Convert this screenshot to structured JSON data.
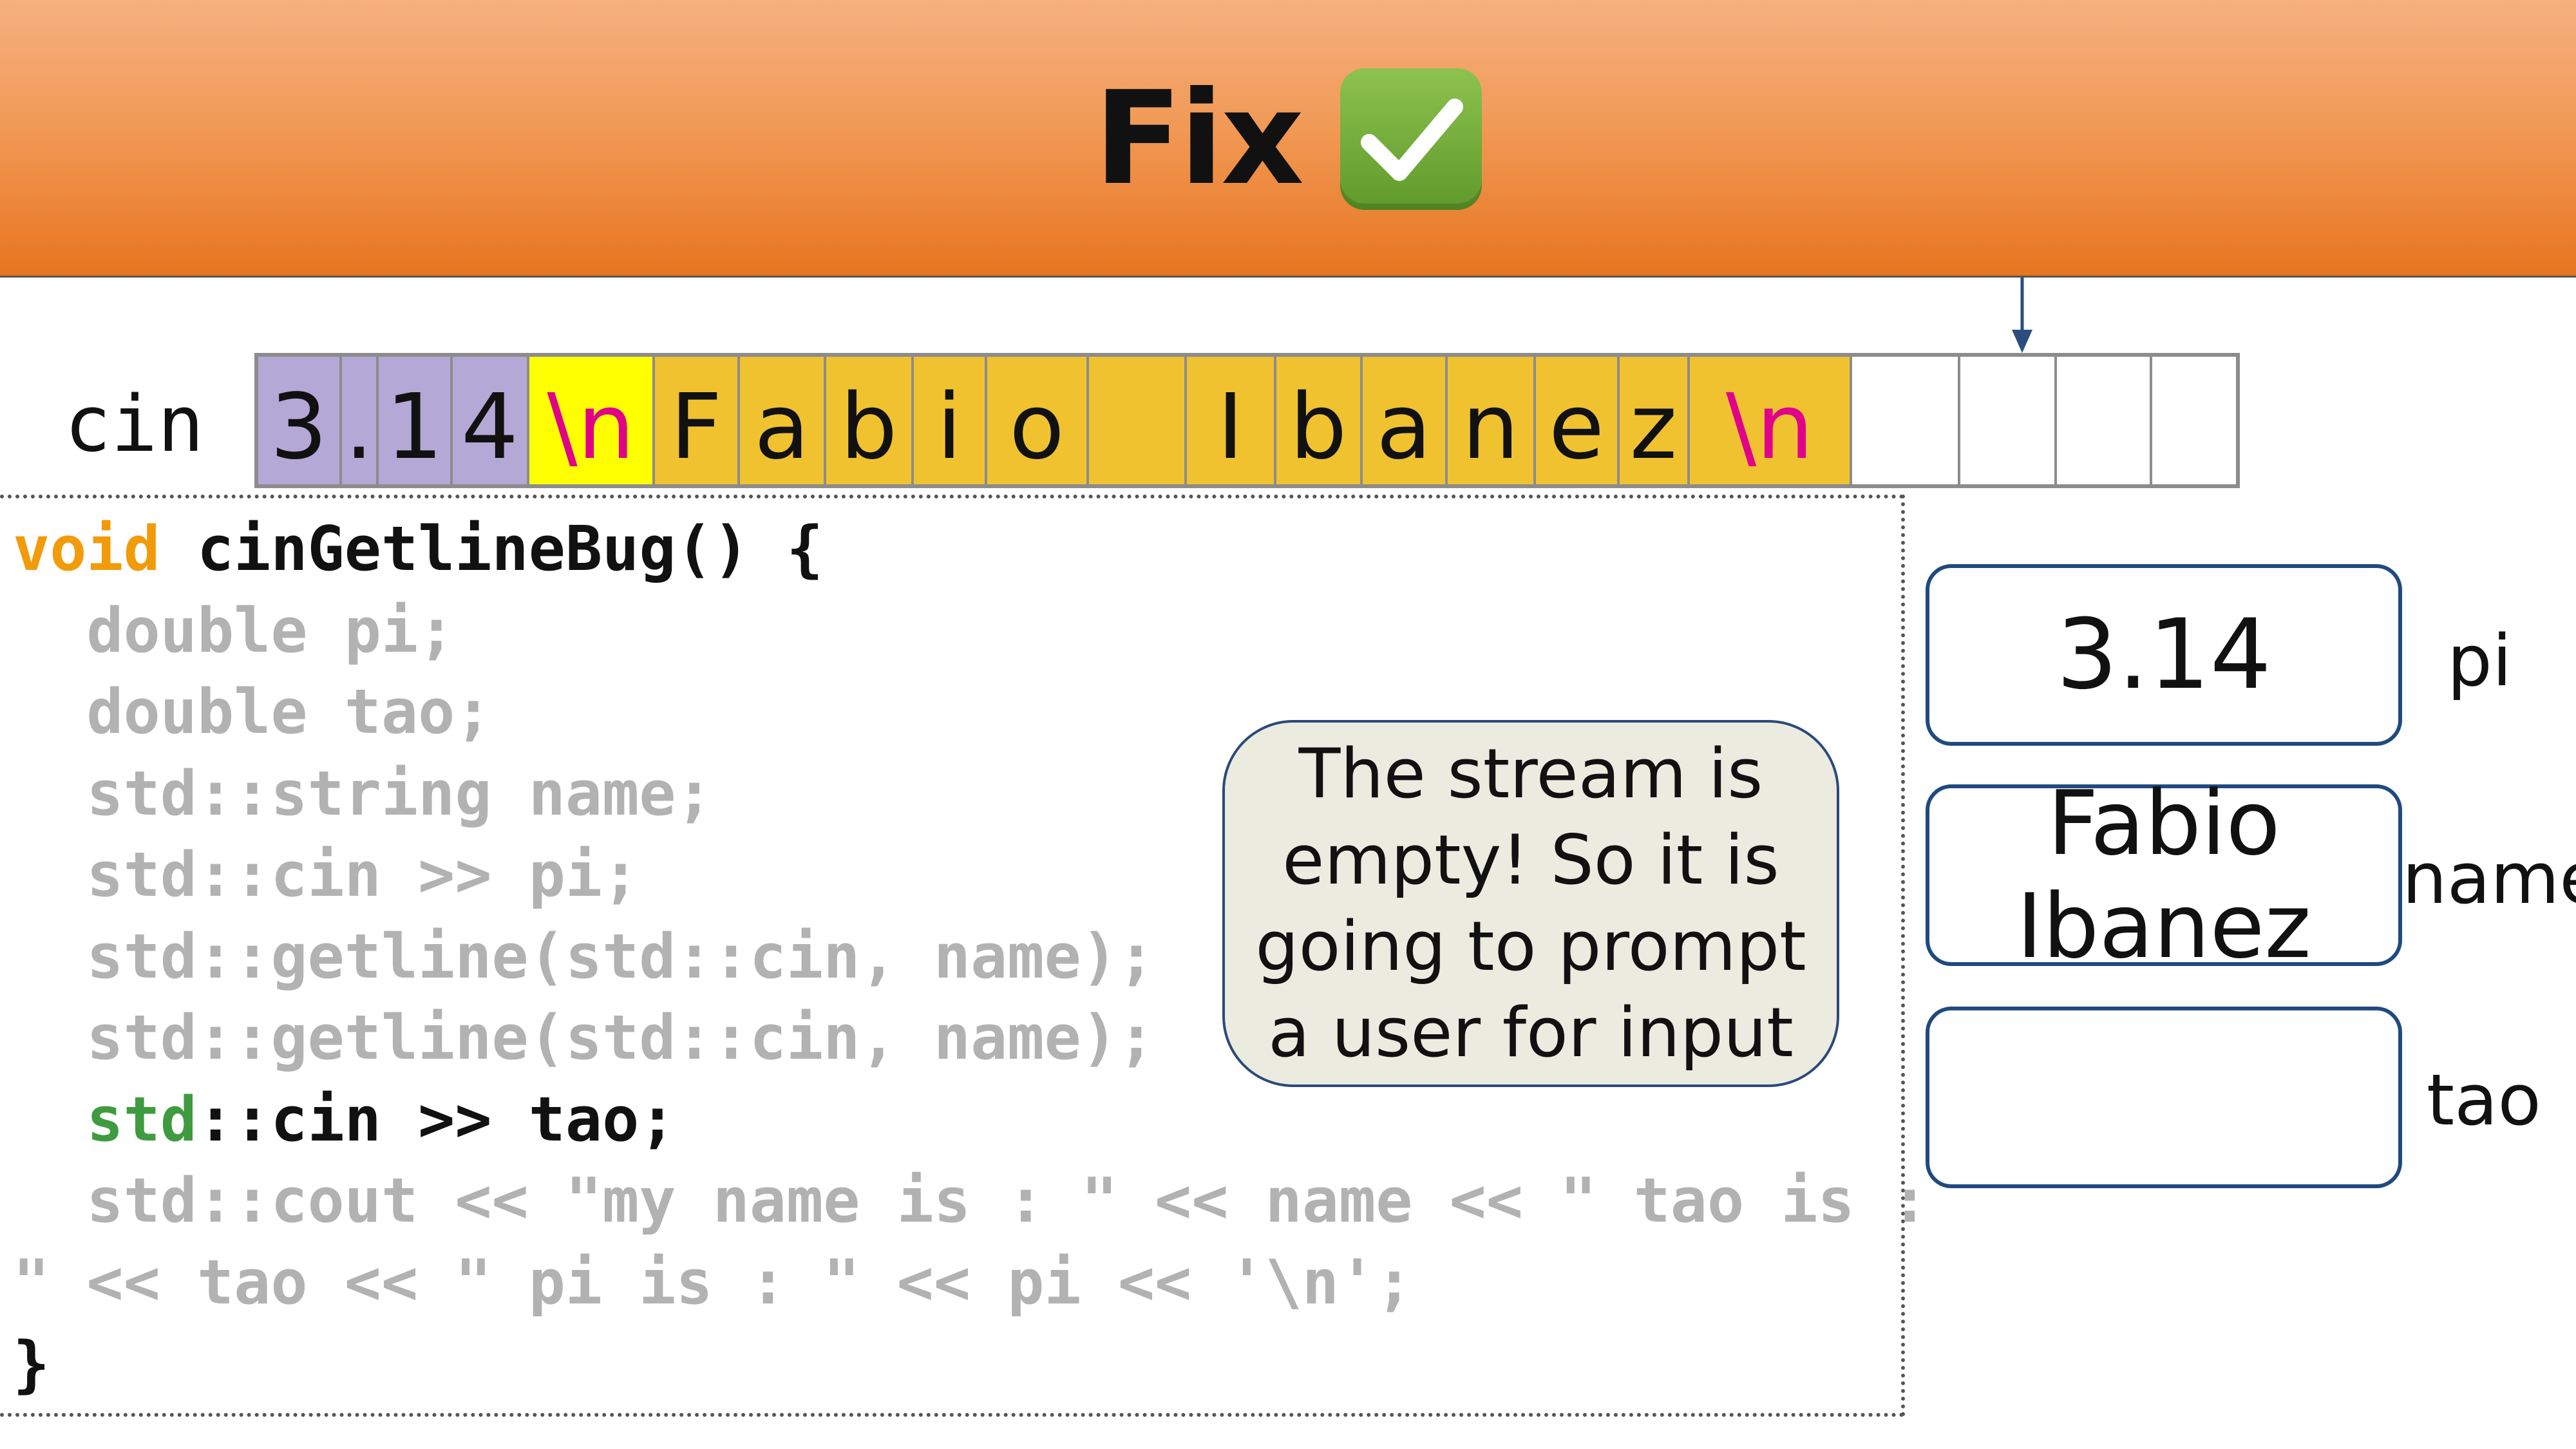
{
  "slide": {
    "title": "Fix",
    "title_icon": "check-mark-button-icon",
    "colors": {
      "banner_top": "#f6b07e",
      "banner_bottom": "#e7751f",
      "num_cell": "#b3a8d6",
      "newline_cell": "#ffff00",
      "text_cell": "#f0c230",
      "newline_text": "#e0008a",
      "box_border": "#1f4a80"
    }
  },
  "stream": {
    "label": "cin",
    "cells": [
      {
        "ch": "3",
        "kind": "num"
      },
      {
        "ch": ".",
        "kind": "num"
      },
      {
        "ch": "1",
        "kind": "num"
      },
      {
        "ch": "4",
        "kind": "num"
      },
      {
        "ch": "\\n",
        "kind": "nl1"
      },
      {
        "ch": "F",
        "kind": "txt"
      },
      {
        "ch": "a",
        "kind": "txt"
      },
      {
        "ch": "b",
        "kind": "txt"
      },
      {
        "ch": "i",
        "kind": "txt"
      },
      {
        "ch": "o",
        "kind": "txt"
      },
      {
        "ch": "",
        "kind": "txt"
      },
      {
        "ch": "I",
        "kind": "txt"
      },
      {
        "ch": "b",
        "kind": "txt"
      },
      {
        "ch": "a",
        "kind": "txt"
      },
      {
        "ch": "n",
        "kind": "txt"
      },
      {
        "ch": "e",
        "kind": "txt"
      },
      {
        "ch": "z",
        "kind": "txt"
      },
      {
        "ch": "\\n",
        "kind": "nl2"
      },
      {
        "ch": "",
        "kind": "empty"
      },
      {
        "ch": "",
        "kind": "empty"
      },
      {
        "ch": "",
        "kind": "empty"
      },
      {
        "ch": "",
        "kind": "empty"
      }
    ]
  },
  "code": {
    "line1_kw": "void",
    "line1_rest": " cinGetlineBug() {",
    "line2": "  double pi;",
    "line3": "  double tao;",
    "line4": "  std::string name;",
    "line5": "  std::cin >> pi;",
    "line6": "  std::getline(std::cin, name);",
    "line7": "  std::getline(std::cin, name);",
    "line8_indent": "  ",
    "line8_std": "std",
    "line8_rest": "::cin >> tao;",
    "line9": "  std::cout << \"my name is : \" << name << \" tao is :",
    "line10": "\" << tao << \" pi is : \" << pi << '\\n';",
    "line11": "}"
  },
  "callout": {
    "text": "The stream is empty! So it is going to prompt a user for input"
  },
  "variables": {
    "pi": {
      "label": "pi",
      "value": "3.14"
    },
    "name": {
      "label": "name",
      "value": "Fabio Ibanez"
    },
    "tao": {
      "label": "tao",
      "value": ""
    }
  }
}
